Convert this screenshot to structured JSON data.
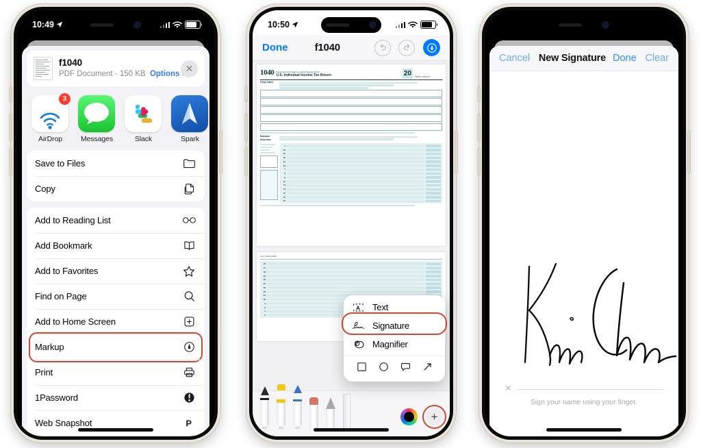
{
  "phone1": {
    "status": {
      "time": "10:49",
      "location_icon": "location-arrow-icon",
      "signal_icon": "cellular-bars-icon",
      "wifi_icon": "wifi-icon",
      "battery_icon": "battery-icon"
    },
    "share_sheet": {
      "doc_title": "f1040",
      "doc_subtitle": "PDF Document - 150 KB",
      "options_label": "Options",
      "options_chevron": "›",
      "close_label": "✕",
      "apps": [
        {
          "name": "AirDrop",
          "icon": "airdrop-icon",
          "badge": "3"
        },
        {
          "name": "Messages",
          "icon": "messages-icon",
          "badge": ""
        },
        {
          "name": "Slack",
          "icon": "slack-icon",
          "badge": ""
        },
        {
          "name": "Spark",
          "icon": "spark-icon",
          "badge": ""
        }
      ],
      "groups": [
        {
          "rows": [
            {
              "label": "Save to Files",
              "icon": "folder-icon"
            },
            {
              "label": "Copy",
              "icon": "copy-icon"
            }
          ]
        },
        {
          "rows": [
            {
              "label": "Add to Reading List",
              "icon": "glasses-icon"
            },
            {
              "label": "Add Bookmark",
              "icon": "book-icon"
            },
            {
              "label": "Add to Favorites",
              "icon": "star-icon"
            },
            {
              "label": "Find on Page",
              "icon": "search-icon"
            },
            {
              "label": "Add to Home Screen",
              "icon": "plus-square-icon"
            },
            {
              "label": "Markup",
              "icon": "markup-pen-icon",
              "highlighted": true
            },
            {
              "label": "Print",
              "icon": "printer-icon"
            },
            {
              "label": "1Password",
              "icon": "onepassword-icon"
            },
            {
              "label": "Web Snapshot",
              "icon": "web-snapshot-icon"
            }
          ]
        }
      ]
    }
  },
  "phone2": {
    "status": {
      "time": "10:50"
    },
    "nav": {
      "done_label": "Done",
      "title": "f1040",
      "undo_icon": "undo-icon",
      "redo_icon": "redo-icon",
      "markup_icon": "markup-pen-icon"
    },
    "document": {
      "form_number": "1040",
      "form_agency": "Department of the Treasury—Internal Revenue Service",
      "form_title": "U.S. Individual Income Tax Return",
      "form_year": "20",
      "omb": "OMB No. 1545-0074",
      "filing_status_label": "Filing Status",
      "standard_deduction_label": "Standard Deduction",
      "page2_label": "Form 1040 (2020)"
    },
    "add_menu": {
      "items": [
        {
          "label": "Text",
          "icon": "text-box-icon",
          "highlighted": false
        },
        {
          "label": "Signature",
          "icon": "signature-icon",
          "highlighted": true
        },
        {
          "label": "Magnifier",
          "icon": "magnifier-icon",
          "highlighted": false
        }
      ],
      "shapes": [
        {
          "icon": "square-shape-icon"
        },
        {
          "icon": "circle-shape-icon"
        },
        {
          "icon": "speech-bubble-shape-icon"
        },
        {
          "icon": "arrow-shape-icon"
        }
      ]
    },
    "palette": {
      "tools": [
        {
          "icon": "pen-tool-icon",
          "size_label": "0.7",
          "color": "#1c1c1e"
        },
        {
          "icon": "highlighter-tool-icon",
          "size_label": "9.0",
          "color": "#f5c518"
        },
        {
          "icon": "marker-tool-icon",
          "size_label": "5.0",
          "color": "#3b73c4"
        },
        {
          "icon": "eraser-tool-icon",
          "size_label": "",
          "color": "#d2756b"
        },
        {
          "icon": "lasso-tool-icon",
          "size_label": "",
          "color": "#8e8e93"
        },
        {
          "icon": "ruler-tool-icon",
          "size_label": "",
          "color": "#c7c7cc"
        }
      ],
      "selected_color": "#000000",
      "color_wheel_icon": "color-wheel-icon",
      "add_label": "+",
      "add_highlighted": true
    }
  },
  "phone3": {
    "nav": {
      "cancel_label": "Cancel",
      "title": "New Signature",
      "done_label": "Done",
      "clear_label": "Clear"
    },
    "canvas": {
      "hint": "Sign your name using your finger.",
      "x_mark": "✕",
      "signature_alt": "handwritten-signature"
    }
  },
  "colors": {
    "ios_blue": "#007aff",
    "highlight_red": "#d1462f",
    "badge_red": "#ff3b30",
    "sheet_bg": "#f2f2f7"
  }
}
